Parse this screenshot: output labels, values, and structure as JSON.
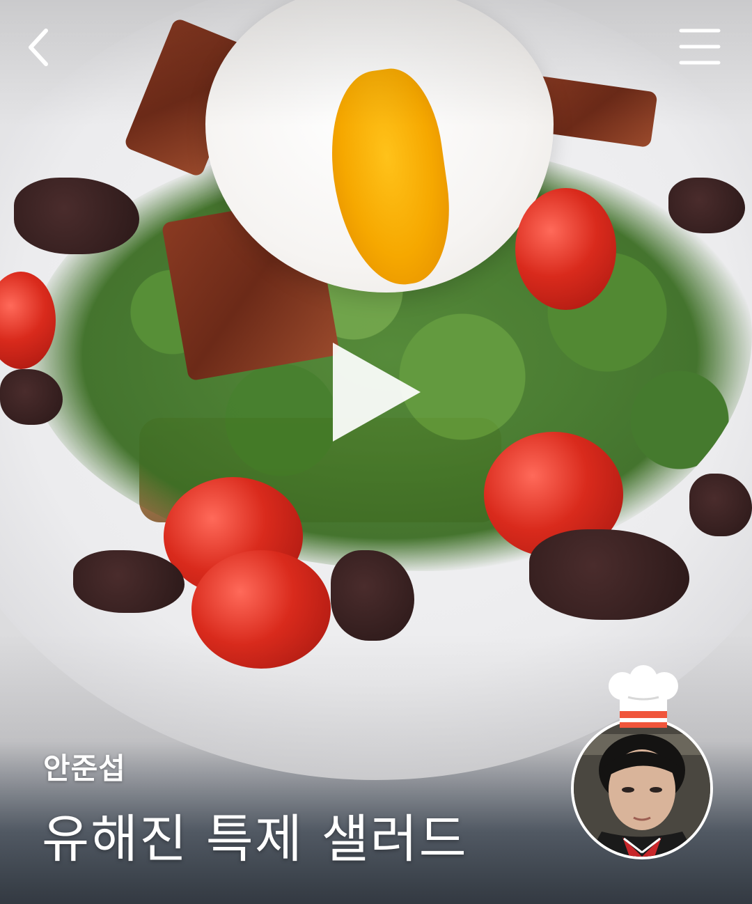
{
  "header": {
    "back_icon": "chevron-left-icon",
    "menu_icon": "hamburger-menu-icon"
  },
  "video": {
    "play_icon": "play-icon"
  },
  "recipe": {
    "author": "안준섭",
    "title": "유해진 특제 샐러드"
  },
  "profile": {
    "badge_icon": "chef-hat-icon",
    "colors": {
      "badge_stripe": "#f0553b",
      "avatar_border": "#ffffff"
    }
  }
}
